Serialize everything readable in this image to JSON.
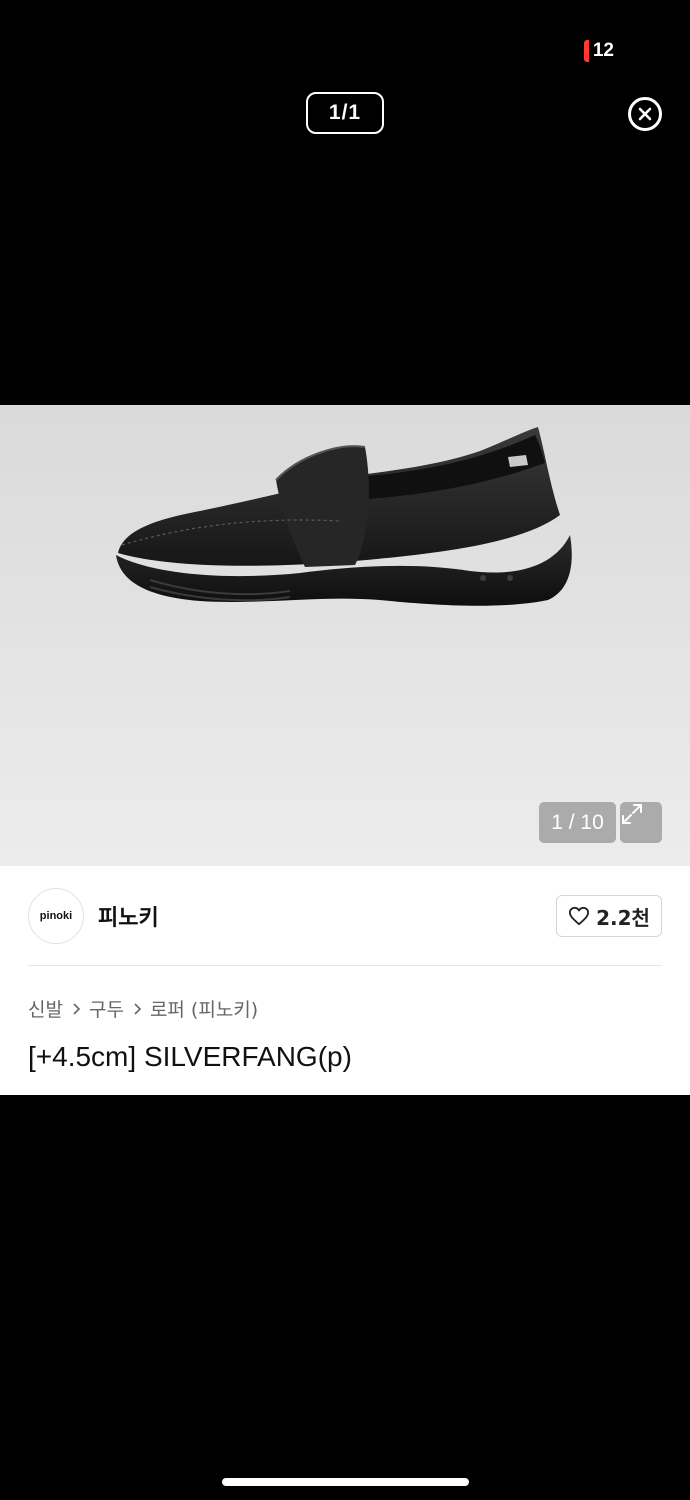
{
  "status": {
    "battery_level": "12",
    "battery_color": "#ff3b30"
  },
  "viewer": {
    "counter": "1/1",
    "close_icon": "close-circle-icon"
  },
  "product": {
    "image_icon": "black-loafer-shoe",
    "image_counter": "1 / 10",
    "expand_icon": "expand-arrows-icon",
    "brand_logo_text": "pinoki",
    "brand_name": "피노키",
    "like_count": "2.2천",
    "breadcrumb": [
      "신발",
      "구두",
      "로퍼 (피노키)"
    ],
    "title": "[+4.5cm] SILVERFANG(p)"
  }
}
